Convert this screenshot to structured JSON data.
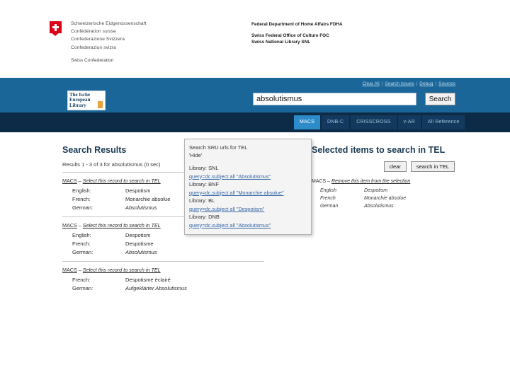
{
  "gov_header": {
    "flag_icon": "swiss-cross-flag",
    "confederation_names": [
      "Schweizerische Eidgenossenschaft",
      "Confédération suisse",
      "Confederazione Svizzera",
      "Confederaziun svizra"
    ],
    "confederation_en": "Swiss Confederation",
    "department_lines": [
      "Federal Department of Home Affairs FDHA",
      "Swiss Federal Office of Culture FOC",
      "Swiss National Library SNL"
    ]
  },
  "app_band": {
    "logo": {
      "line1": "The Ische",
      "line2": "European",
      "line3": "Library"
    },
    "top_links": [
      {
        "label": "Clear All"
      },
      {
        "label": "Search Issues"
      },
      {
        "label": "Debug"
      },
      {
        "label": "Sources"
      }
    ],
    "separator": "|",
    "search": {
      "value": "absolutismus",
      "placeholder": "",
      "button_label": "Search"
    }
  },
  "tabs": [
    {
      "label": "MACS",
      "active": true
    },
    {
      "label": "DNB-C",
      "active": false
    },
    {
      "label": "CRISSCROSS",
      "active": false
    },
    {
      "label": "v-AR",
      "active": false
    },
    {
      "label": "All Reference",
      "active": false
    }
  ],
  "results_panel": {
    "title": "Search Results",
    "meta": "Results 1 - 3 of 3 for absolutismus (0 sec)",
    "records": [
      {
        "source": "MACS",
        "dash": " – ",
        "select_link": "Select this record to search in TEL",
        "terms": [
          {
            "lang": "English:",
            "value": "Despotism",
            "italic": false
          },
          {
            "lang": "French:",
            "value": "Monarchie absolue",
            "italic": false
          },
          {
            "lang": "German:",
            "value": "Absolutismus",
            "italic": true
          }
        ]
      },
      {
        "source": "MACS",
        "dash": " – ",
        "select_link": "Select this record to search in TEL",
        "terms": [
          {
            "lang": "English:",
            "value": "Despotism",
            "italic": false
          },
          {
            "lang": "French:",
            "value": "Despotisme",
            "italic": false
          },
          {
            "lang": "German:",
            "value": "Absolutismus",
            "italic": true
          }
        ]
      },
      {
        "source": "MACS",
        "dash": " – ",
        "select_link": "Select this record to search in TEL",
        "terms": [
          {
            "lang": "French:",
            "value": "Despotisme éclairé",
            "italic": false
          },
          {
            "lang": "German:",
            "value": "Aufgeklärter Absolutismus",
            "italic": true
          }
        ]
      }
    ]
  },
  "selected_panel": {
    "title": "Selected items to search in TEL",
    "clear_label": "clear",
    "search_label": "search in TEL",
    "entry": {
      "source": "MACS",
      "dash": " – ",
      "remove_link": "Remove this item from the selection",
      "terms": [
        {
          "lang": "English",
          "value": "Despotism"
        },
        {
          "lang": "French",
          "value": "Monarchie absolue"
        },
        {
          "lang": "German",
          "value": "Absolutismus"
        }
      ]
    }
  },
  "popup": {
    "title_line1": "Search SRU urls for TEL",
    "title_line2": "'Hide'",
    "entries": [
      {
        "library": "Library: SNL",
        "query": "query=dc.subject all \"Absolutismus\""
      },
      {
        "library": "Library: BNF",
        "query": "query=dc.subject all \"Monarchie absolue\""
      },
      {
        "library": "Library: BL",
        "query": "query=dc.subject all \"Despotism\""
      },
      {
        "library": "Library: DNB",
        "query": "query=dc.subject all \"Absolutismus\""
      }
    ]
  },
  "colors": {
    "band_blue": "#1a6699",
    "tab_strip": "#0d2b47",
    "tab_active": "#2e8bc9",
    "link_blue": "#3465a4",
    "flag_red": "#dc0018"
  }
}
